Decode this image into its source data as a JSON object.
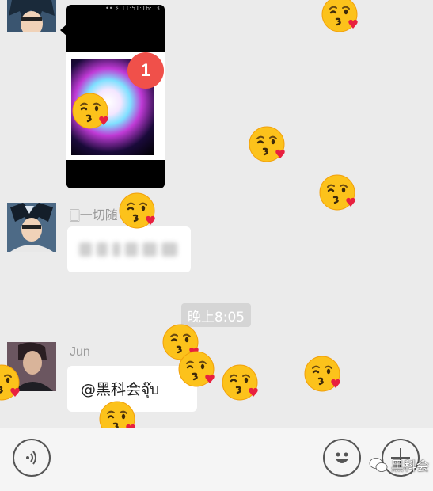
{
  "messages": {
    "image_message": {
      "status_bar_text": "•• ⚡ 11:51:16:13",
      "badge": "1"
    },
    "first_text_message": {
      "sender_name": "🀆一切随"
    },
    "time_divider": "晚上8:05",
    "last_message": {
      "sender_name": "Jun",
      "text": "@黑科会จุ๊บ"
    }
  },
  "watermark": {
    "text": "黑科会"
  },
  "icons": {
    "voice": "voice-icon",
    "emoji": "smiley-icon",
    "plus": "plus-icon",
    "kiss_emoji": "kissing-face-emoji-icon"
  },
  "colors": {
    "background": "#ebebeb",
    "bubble": "#ffffff",
    "badge": "#f0504a",
    "time_pill": "#d5d5d5"
  }
}
